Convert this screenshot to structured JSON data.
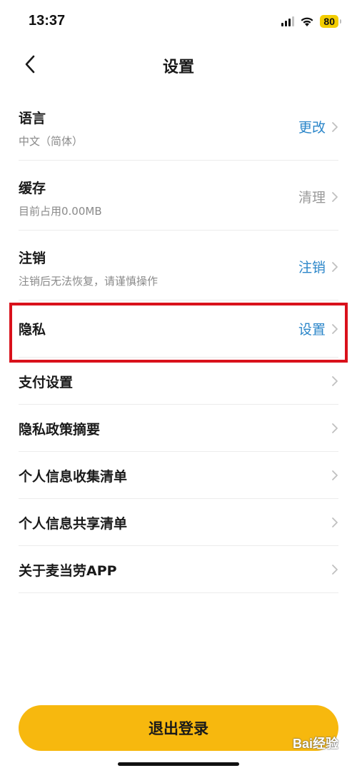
{
  "status_bar": {
    "time": "13:37",
    "battery": "80",
    "icons": [
      "signal-icon",
      "wifi-icon",
      "battery-icon"
    ]
  },
  "nav": {
    "title": "设置",
    "back_icon": "chevron-left-icon"
  },
  "items": [
    {
      "title": "语言",
      "subtitle": "中文（简体）",
      "action": "更改",
      "action_color": "#2b86c9"
    },
    {
      "title": "缓存",
      "subtitle": "目前占用0.00MB",
      "action": "清理",
      "action_color": "#9a9a9a"
    },
    {
      "title": "注销",
      "subtitle": "注销后无法恢复，请谨慎操作",
      "action": "注销",
      "action_color": "#2b86c9"
    },
    {
      "title": "隐私",
      "action": "设置",
      "action_color": "#2b86c9"
    },
    {
      "title": "支付设置"
    },
    {
      "title": "隐私政策摘要"
    },
    {
      "title": "个人信息收集清单"
    },
    {
      "title": "个人信息共享清单"
    },
    {
      "title": "关于麦当劳APP"
    }
  ],
  "logout_label": "退出登录",
  "watermark": "Bai经验",
  "colors": {
    "accent_yellow": "#f7b80e",
    "link_blue": "#2b86c9",
    "highlight_red": "#d9111b"
  }
}
